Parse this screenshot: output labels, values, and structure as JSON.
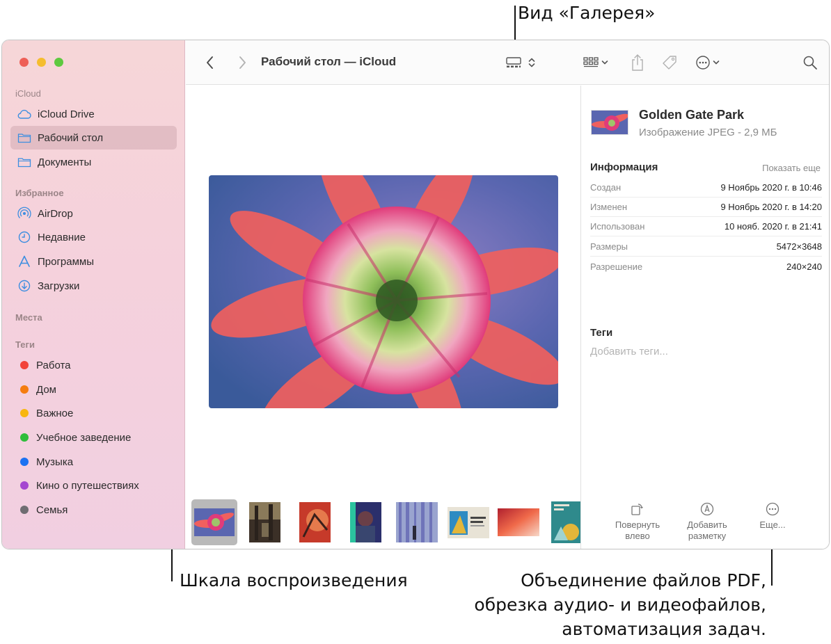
{
  "callouts": {
    "gallery_view": "Вид «Галерея»",
    "scrubber": "Шкала воспроизведения",
    "more_line1": "Объединение файлов PDF,",
    "more_line2": "обрезка аудио- и видеофайлов,",
    "more_line3": "автоматизация задач."
  },
  "window": {
    "title": "Рабочий стол — iCloud",
    "traffic_colors": [
      "#ee5f57",
      "#f5bd2f",
      "#5ec93f"
    ]
  },
  "sidebar": {
    "sections": {
      "icloud": "iCloud",
      "favorites": "Избранное",
      "places": "Места",
      "tags": "Теги"
    },
    "icloud_items": [
      {
        "label": "iCloud Drive",
        "icon": "cloud-icon"
      },
      {
        "label": "Рабочий стол",
        "icon": "folder-icon",
        "selected": true
      },
      {
        "label": "Документы",
        "icon": "folder-icon"
      }
    ],
    "favorite_items": [
      {
        "label": "AirDrop",
        "icon": "airdrop-icon"
      },
      {
        "label": "Недавние",
        "icon": "clock-icon"
      },
      {
        "label": "Программы",
        "icon": "apps-icon"
      },
      {
        "label": "Загрузки",
        "icon": "download-icon"
      }
    ],
    "tag_items": [
      {
        "label": "Работа",
        "color": "#f2423a"
      },
      {
        "label": "Дом",
        "color": "#f57d10"
      },
      {
        "label": "Важное",
        "color": "#f8b60f"
      },
      {
        "label": "Учебное заведение",
        "color": "#2fbd3b"
      },
      {
        "label": "Музыка",
        "color": "#1c72f2"
      },
      {
        "label": "Кино о путешествиях",
        "color": "#a547d0"
      },
      {
        "label": "Семья",
        "color": "#6f6d72"
      }
    ]
  },
  "toolbar": {
    "icons": [
      "back-icon",
      "forward-icon",
      "gallery-view-icon",
      "group-icon",
      "share-icon",
      "tag-icon",
      "more-icon",
      "search-icon"
    ],
    "accent": "#3f3f3f"
  },
  "inspector": {
    "file_name": "Golden Gate Park",
    "file_kind": "Изображение JPEG - 2,9 МБ",
    "info_heading": "Информация",
    "show_more": "Показать еще",
    "rows": [
      {
        "label": "Создан",
        "value": "9 Ноябрь 2020 г. в 10:46"
      },
      {
        "label": "Изменен",
        "value": "9 Ноябрь 2020 г. в 14:20"
      },
      {
        "label": "Использован",
        "value": "10 нояб. 2020 г. в 21:41"
      },
      {
        "label": "Размеры",
        "value": "5472×3648"
      },
      {
        "label": "Разрешение",
        "value": "240×240"
      }
    ],
    "tags_heading": "Теги",
    "add_tags_placeholder": "Добавить теги...",
    "actions": [
      {
        "line1": "Повернуть",
        "line2": "влево",
        "icon": "rotate-left-icon"
      },
      {
        "line1": "Добавить",
        "line2": "разметку",
        "icon": "markup-icon"
      },
      {
        "line1": "Еще...",
        "line2": "",
        "icon": "more-circle-icon"
      }
    ]
  }
}
